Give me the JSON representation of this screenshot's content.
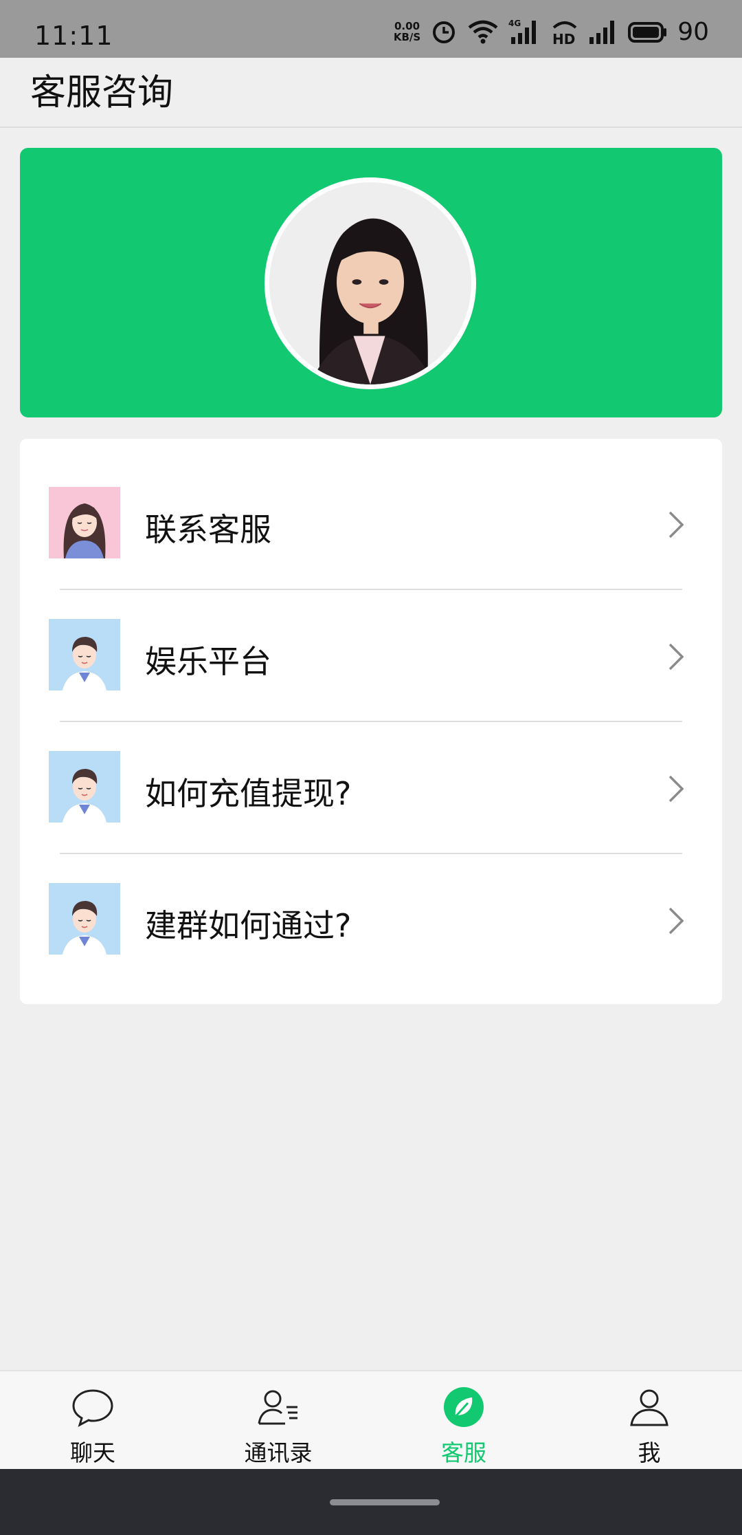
{
  "status_bar": {
    "time": "11:11",
    "net_speed_value": "0.00",
    "net_speed_unit": "KB/S",
    "network_type": "4G",
    "hd": "HD",
    "battery": "90"
  },
  "header": {
    "title": "客服咨询"
  },
  "banner": {
    "avatar": "customer-service-avatar",
    "color": "#12c971"
  },
  "menu": {
    "items": [
      {
        "label": "联系客服",
        "avatar": "female-avatar"
      },
      {
        "label": "娱乐平台",
        "avatar": "male-avatar"
      },
      {
        "label": "如何充值提现?",
        "avatar": "male-avatar"
      },
      {
        "label": "建群如何通过?",
        "avatar": "male-avatar"
      }
    ]
  },
  "tabbar": {
    "tabs": [
      {
        "label": "聊天",
        "icon": "chat-bubble-icon"
      },
      {
        "label": "通讯录",
        "icon": "contacts-icon"
      },
      {
        "label": "客服",
        "icon": "leaf-icon",
        "active": true
      },
      {
        "label": "我",
        "icon": "person-icon"
      }
    ],
    "active_color": "#12c971"
  }
}
